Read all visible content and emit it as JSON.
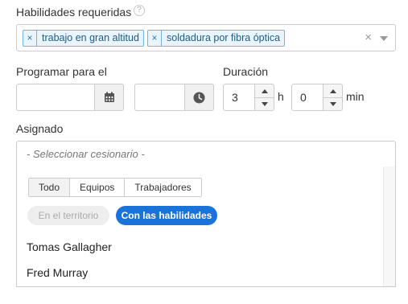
{
  "skills": {
    "label": "Habilidades requeridas",
    "help_glyph": "?",
    "tags": [
      {
        "remove_glyph": "×",
        "label": "trabajo en gran altitud"
      },
      {
        "remove_glyph": "×",
        "label": "soldadura por fibra óptica"
      }
    ],
    "clear_glyph": "×"
  },
  "schedule": {
    "label": "Programar para el",
    "date_value": "",
    "time_value": ""
  },
  "duration": {
    "label": "Duración",
    "hours_value": "3",
    "hours_unit": "h",
    "minutes_value": "0",
    "minutes_unit": "min"
  },
  "assigned": {
    "label": "Asignado",
    "placeholder": "- Seleccionar cesionario -",
    "filter_tabs": [
      "Todo",
      "Equipos",
      "Trabajadores"
    ],
    "active_tab": "Todo",
    "toggle_off_label": "En el territorio",
    "toggle_on_label": "Con las habilidades",
    "people": [
      "Tomas Gallagher",
      "Fred Murray"
    ]
  },
  "colors": {
    "tag_bg": "#e9f4fc",
    "tag_border": "#6fb5e0",
    "primary_pill": "#1a73d9"
  }
}
